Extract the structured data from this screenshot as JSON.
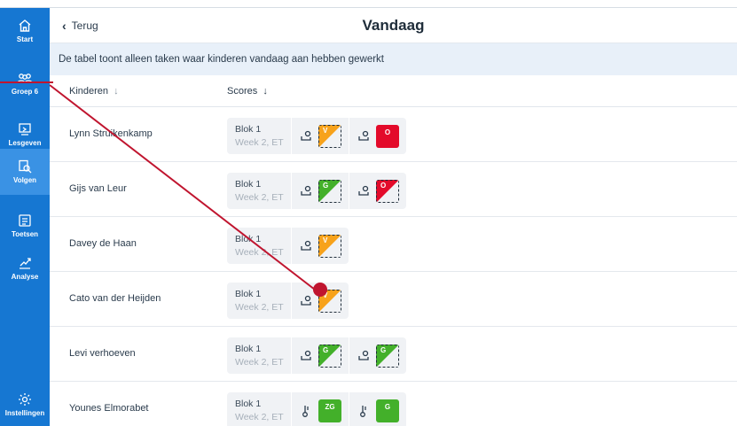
{
  "nav": {
    "items": [
      {
        "label": "Start",
        "icon": "home-icon"
      },
      {
        "label": "Groep 6",
        "icon": "group-icon"
      },
      {
        "label": "Lesgeven",
        "icon": "teach-icon"
      },
      {
        "label": "Volgen",
        "icon": "follow-icon"
      },
      {
        "label": "Toetsen",
        "icon": "test-icon"
      },
      {
        "label": "Analyse",
        "icon": "analysis-icon"
      },
      {
        "label": "Instellingen",
        "icon": "settings-icon"
      }
    ]
  },
  "header": {
    "back_label": "Terug",
    "title": "Vandaag"
  },
  "info_text": "De tabel toont alleen taken waar kinderen vandaag aan hebben gewerkt",
  "table": {
    "col_children": "Kinderen",
    "col_scores": "Scores",
    "rows": [
      {
        "name": "Lynn Struikenkamp",
        "blok": "Blok 1",
        "week": "Week 2, ET"
      },
      {
        "name": "Gijs van Leur",
        "blok": "Blok 1",
        "week": "Week 2, ET"
      },
      {
        "name": "Davey de Haan",
        "blok": "Blok 1",
        "week": "Week 2, ET"
      },
      {
        "name": "Cato van der Heijden",
        "blok": "Blok 1",
        "week": "Week 2, ET"
      },
      {
        "name": "Levi verhoeven",
        "blok": "Blok 1",
        "week": "Week 2, ET"
      },
      {
        "name": "Younes Elmorabet",
        "blok": "Blok 1",
        "week": "Week 2, ET"
      }
    ]
  },
  "score_labels": {
    "v": "V",
    "o": "O",
    "g": "G",
    "zg": "ZG"
  },
  "colors": {
    "sidebar": "#1677d2",
    "orange": "#f7a21b",
    "red": "#e30a2a",
    "green": "#43b02a",
    "annotation": "#c0152f"
  }
}
